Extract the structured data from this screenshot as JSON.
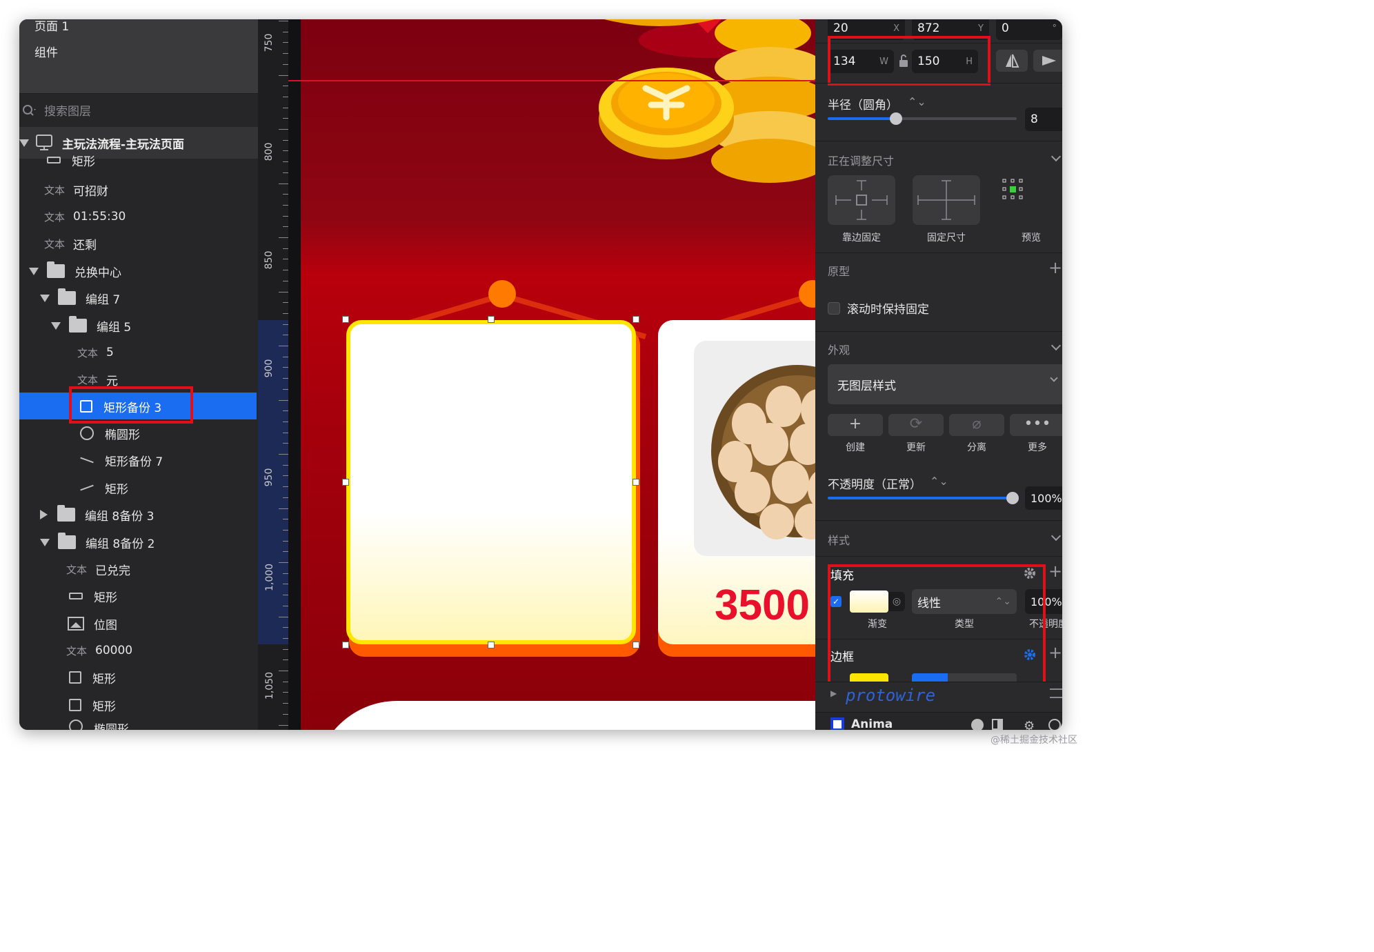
{
  "layers_panel": {
    "pages": [
      "页面 1",
      "组件"
    ],
    "search_placeholder": "搜索图层",
    "artboard": "主玩法流程-主玩法页面",
    "items": [
      {
        "kind": "",
        "label": "矩形"
      },
      {
        "kind": "文本",
        "label": "可招财"
      },
      {
        "kind": "文本",
        "label": "01:55:30"
      },
      {
        "kind": "文本",
        "label": "还剩"
      },
      {
        "kind": "",
        "label": "兑换中心"
      },
      {
        "kind": "",
        "label": "编组 7"
      },
      {
        "kind": "",
        "label": "编组 5"
      },
      {
        "kind": "文本",
        "label": "5"
      },
      {
        "kind": "文本",
        "label": "元"
      },
      {
        "kind": "",
        "label": "矩形备份 3"
      },
      {
        "kind": "",
        "label": "椭圆形"
      },
      {
        "kind": "",
        "label": "矩形备份 7"
      },
      {
        "kind": "",
        "label": "矩形"
      },
      {
        "kind": "",
        "label": "编组 8备份 3"
      },
      {
        "kind": "",
        "label": "编组 8备份 2"
      },
      {
        "kind": "文本",
        "label": "已兑完"
      },
      {
        "kind": "",
        "label": "矩形"
      },
      {
        "kind": "",
        "label": "位图"
      },
      {
        "kind": "文本",
        "label": "60000"
      },
      {
        "kind": "",
        "label": "矩形"
      },
      {
        "kind": "",
        "label": "矩形"
      },
      {
        "kind": "",
        "label": "椭圆形"
      }
    ]
  },
  "ruler": {
    "labels": [
      "750",
      "800",
      "850",
      "900",
      "950",
      "1,000",
      "1,050"
    ]
  },
  "canvas": {
    "price_text": "3500",
    "colors": {
      "selection": "#ffe600",
      "price": "#e8102a",
      "background": "#a6000c"
    }
  },
  "inspector": {
    "x": "20",
    "x_suffix": "X",
    "y": "872",
    "y_suffix": "Y",
    "rotation": "0",
    "w": "134",
    "w_suffix": "W",
    "h": "150",
    "h_suffix": "H",
    "radius_label": "半径（圆角）",
    "radius_value": "8",
    "radius_fraction": 0.36,
    "resizing_label": "正在调整尺寸",
    "resize_options": [
      "靠边固定",
      "固定尺寸",
      "预览"
    ],
    "prototype_label": "原型",
    "fix_on_scroll": "滚动时保持固定",
    "appearance_label": "外观",
    "layer_style": "无图层样式",
    "style_actions": [
      "创建",
      "更新",
      "分离",
      "更多"
    ],
    "opacity_label": "不透明度（正常）",
    "opacity_value": "100%",
    "opacity_fraction": 1.0,
    "style_label": "样式",
    "fill_label": "填充",
    "fill_type": "线性",
    "fill_opacity": "100%",
    "fill_captions": [
      "渐变",
      "类型",
      "不透明度"
    ],
    "border_label": "边框",
    "plugin_label": "protowire",
    "anima_label": "Anima"
  },
  "watermark": "@稀土掘金技术社区"
}
